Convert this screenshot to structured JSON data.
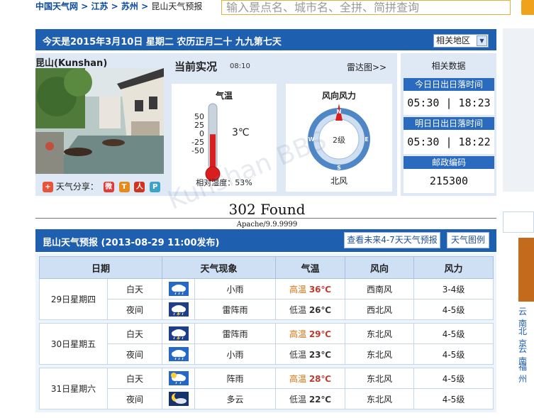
{
  "breadcrumb": {
    "site": "中国天气网",
    "sep": " > ",
    "province": "江苏",
    "city": "苏州",
    "current": "昆山天气预报"
  },
  "search": {
    "placeholder": "输入景点名、城市名、全拼、简拼查询"
  },
  "datebar": {
    "text": "今天是2015年3月10日 星期二 农历正月二十 九九第七天",
    "region_select": "相关地区"
  },
  "city": {
    "name": "昆山(Kunshan)",
    "share_label": "天气分享："
  },
  "now": {
    "title": "当前实况",
    "time": "08:10",
    "radar_link": "雷达图>>",
    "temp_card": {
      "title": "气温",
      "value": "3℃",
      "scale": [
        "50",
        "25",
        "0",
        "-25",
        "-50"
      ],
      "fill_level": 0.53,
      "humidity": "相对湿度：53%"
    },
    "wind_card": {
      "title": "风向风力",
      "level": "2级",
      "direction": "北风",
      "compass": [
        "N",
        "E",
        "S",
        "W"
      ]
    }
  },
  "data_panel": {
    "title": "相关数据",
    "today_sun_label": "今日日出日落时间",
    "today_sun_value": "05:30 | 18:23",
    "tomorrow_sun_label": "明日日出日落时间",
    "tomorrow_sun_value": "05:30 | 18:22",
    "postcode_label": "邮政编码",
    "postcode_value": "215300"
  },
  "error": {
    "title": "302 Found",
    "server": "Apache/9.9.9999"
  },
  "forecast": {
    "title": "昆山天气预报 (2013-08-29  11:00发布)",
    "btn_more": "查看未来4-7天天气预报",
    "btn_legend": "天气图例",
    "headers": [
      "日期",
      "天气现象",
      "气温",
      "风向",
      "风力"
    ],
    "days": [
      {
        "date": "29日星期四",
        "day": {
          "period": "白天",
          "icon": "light-rain-icon",
          "weather": "小雨",
          "temp_label": "高温",
          "temp": "36℃",
          "wind_dir": "西南风",
          "wind_force": "3-4级"
        },
        "night": {
          "period": "夜间",
          "icon": "thundershower-icon",
          "weather": "雷阵雨",
          "temp_label": "低温",
          "temp": "26℃",
          "wind_dir": "西北风",
          "wind_force": "4-5级"
        }
      },
      {
        "date": "30日星期五",
        "day": {
          "period": "白天",
          "icon": "thundershower-icon",
          "weather": "雷阵雨",
          "temp_label": "高温",
          "temp": "29℃",
          "wind_dir": "东北风",
          "wind_force": "4-5级"
        },
        "night": {
          "period": "夜间",
          "icon": "light-rain-icon",
          "weather": "小雨",
          "temp_label": "低温",
          "temp": "23℃",
          "wind_dir": "东北风",
          "wind_force": "4-5级"
        }
      },
      {
        "date": "31日星期六",
        "day": {
          "period": "白天",
          "icon": "shower-icon",
          "weather": "阵雨",
          "temp_label": "高温",
          "temp": "28℃",
          "wind_dir": "东北风",
          "wind_force": "4-5级"
        },
        "night": {
          "period": "夜间",
          "icon": "cloudy-night-icon",
          "weather": "多云",
          "temp_label": "低温",
          "temp": "22℃",
          "wind_dir": "东北风",
          "wind_force": "4-5级"
        }
      }
    ]
  },
  "right_links": [
    "云南",
    "北京",
    "云南",
    "福州"
  ],
  "watermark": "Kunshan BBS"
}
